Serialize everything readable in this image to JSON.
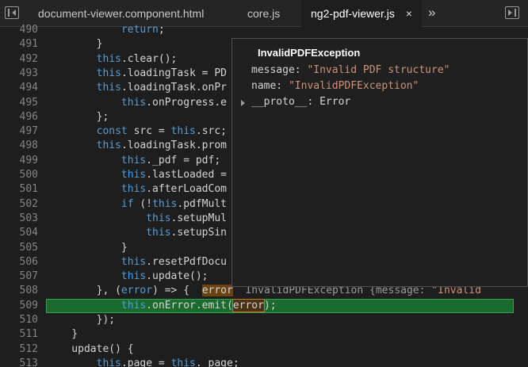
{
  "tabs": [
    {
      "label": "document-viewer.component.html",
      "active": false
    },
    {
      "label": "core.js",
      "active": false
    },
    {
      "label": "ng2-pdf-viewer.js",
      "active": true,
      "close": "×"
    }
  ],
  "overflow_label": "»",
  "lines": [
    {
      "num": "490",
      "code": "            return;"
    },
    {
      "num": "491",
      "code": "        }"
    },
    {
      "num": "492",
      "code": "        this.clear();"
    },
    {
      "num": "493",
      "code": "        this.loadingTask = PD"
    },
    {
      "num": "494",
      "code": "        this.loadingTask.onPr"
    },
    {
      "num": "495",
      "code": "            this.onProgress.e"
    },
    {
      "num": "496",
      "code": "        };"
    },
    {
      "num": "497",
      "code": "        const src = this.src;"
    },
    {
      "num": "498",
      "code": "        this.loadingTask.prom"
    },
    {
      "num": "499",
      "code": "            this._pdf = pdf;"
    },
    {
      "num": "500",
      "code": "            this.lastLoaded ="
    },
    {
      "num": "501",
      "code": "            this.afterLoadCom"
    },
    {
      "num": "502",
      "code": "            if (!this.pdfMult"
    },
    {
      "num": "503",
      "code": "                this.setupMul"
    },
    {
      "num": "504",
      "code": "                this.setupSin"
    },
    {
      "num": "505",
      "code": "            }"
    },
    {
      "num": "506",
      "code": "            this.resetPdfDocu"
    },
    {
      "num": "507",
      "code": "            this.update();"
    },
    {
      "num": "508",
      "code": "        }, (error) => {  error  InvalidPDFException {message: \"Invalid"
    },
    {
      "num": "509",
      "code": "            this.onError.emit(error);"
    },
    {
      "num": "510",
      "code": "        });"
    },
    {
      "num": "511",
      "code": "    }"
    },
    {
      "num": "512",
      "code": "    update() {"
    },
    {
      "num": "513",
      "code": "        this.page = this._page;"
    }
  ],
  "popover": {
    "title": "InvalidPDFException",
    "rows": [
      {
        "key": "message: ",
        "value": "\"Invalid PDF structure\""
      },
      {
        "key": "name: ",
        "value": "\"InvalidPDFException\""
      },
      {
        "key": "__proto__: ",
        "value": "Error"
      }
    ]
  },
  "colors": {
    "background": "#1e1e1e",
    "keyword": "#569cd6",
    "string": "#ce9178",
    "highlight": "#1b6b2e"
  }
}
